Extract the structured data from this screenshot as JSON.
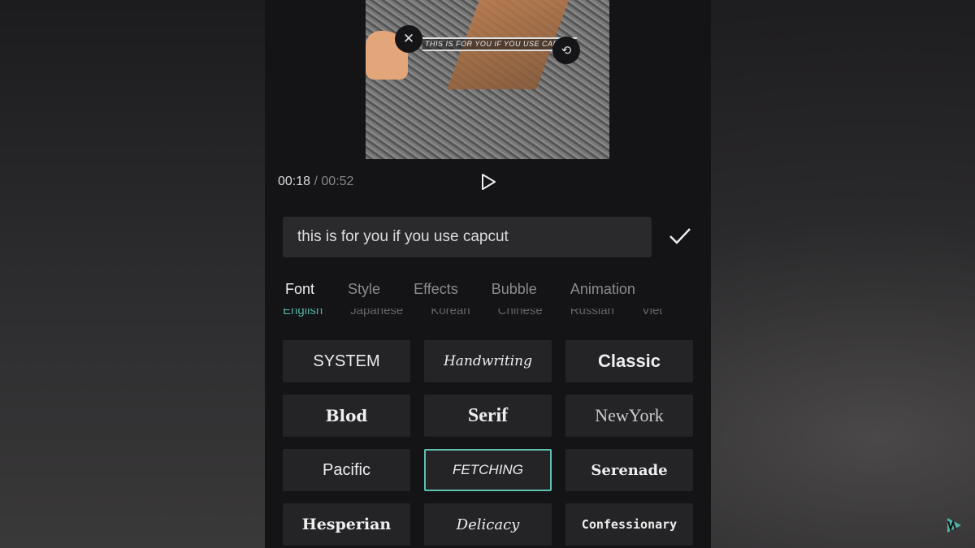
{
  "preview": {
    "caption": "THIS IS FOR YOU IF YOU USE CAPCUT"
  },
  "player": {
    "current": "00:18",
    "separator": "/",
    "total": "00:52"
  },
  "editor": {
    "text_value": "this is for you if you use capcut"
  },
  "tabs": [
    {
      "label": "Font",
      "active": true
    },
    {
      "label": "Style"
    },
    {
      "label": "Effects"
    },
    {
      "label": "Bubble"
    },
    {
      "label": "Animation"
    }
  ],
  "languages": [
    "English",
    "Japanese",
    "Korean",
    "Chinese",
    "Russian",
    "Viet"
  ],
  "fonts": [
    {
      "label": "SYSTEM"
    },
    {
      "label": "Handwriting"
    },
    {
      "label": "Classic"
    },
    {
      "label": "Blod"
    },
    {
      "label": "Serif"
    },
    {
      "label": "NewYork"
    },
    {
      "label": "Pacific"
    },
    {
      "label": "FETCHING",
      "selected": true
    },
    {
      "label": "Serenade"
    },
    {
      "label": "Hesperian"
    },
    {
      "label": "Delicacy"
    },
    {
      "label": "Confessionary"
    }
  ],
  "accent": "#5fc1b0"
}
